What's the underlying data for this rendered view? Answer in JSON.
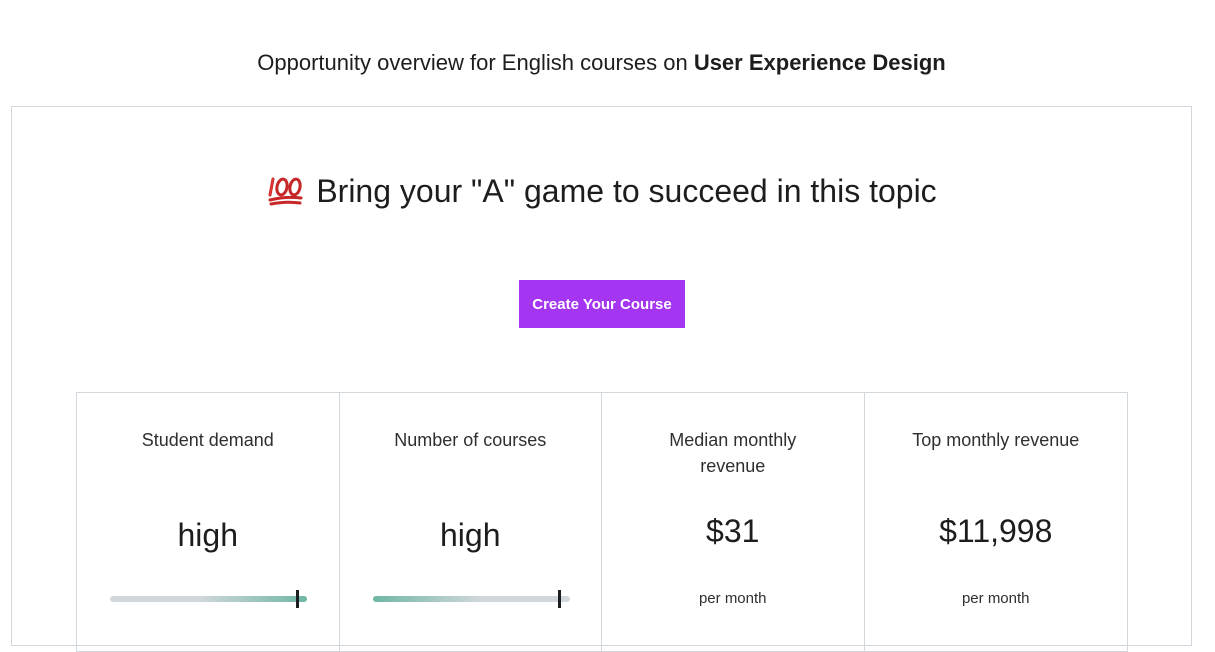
{
  "header": {
    "prefix": "Opportunity overview for English courses on ",
    "topic": "User Experience Design"
  },
  "card": {
    "headline_icon": "hundred-points-emoji",
    "headline": "Bring your \"A\" game to succeed in this topic",
    "cta_label": "Create Your Course"
  },
  "stats": {
    "student_demand": {
      "label": "Student demand",
      "value": "high",
      "level": 0.95
    },
    "number_of_courses": {
      "label": "Number of courses",
      "value": "high",
      "level": 0.95
    },
    "median_monthly_revenue": {
      "label": "Median monthly revenue",
      "value": "$31",
      "sub": "per month"
    },
    "top_monthly_revenue": {
      "label": "Top monthly revenue",
      "value": "$11,998",
      "sub": "per month"
    }
  },
  "colors": {
    "accent": "#a435f0",
    "meter_good": "#6fb6a6",
    "meter_neutral": "#d1d7dc",
    "border": "#d1d7dc",
    "text": "#1c1d1f"
  }
}
